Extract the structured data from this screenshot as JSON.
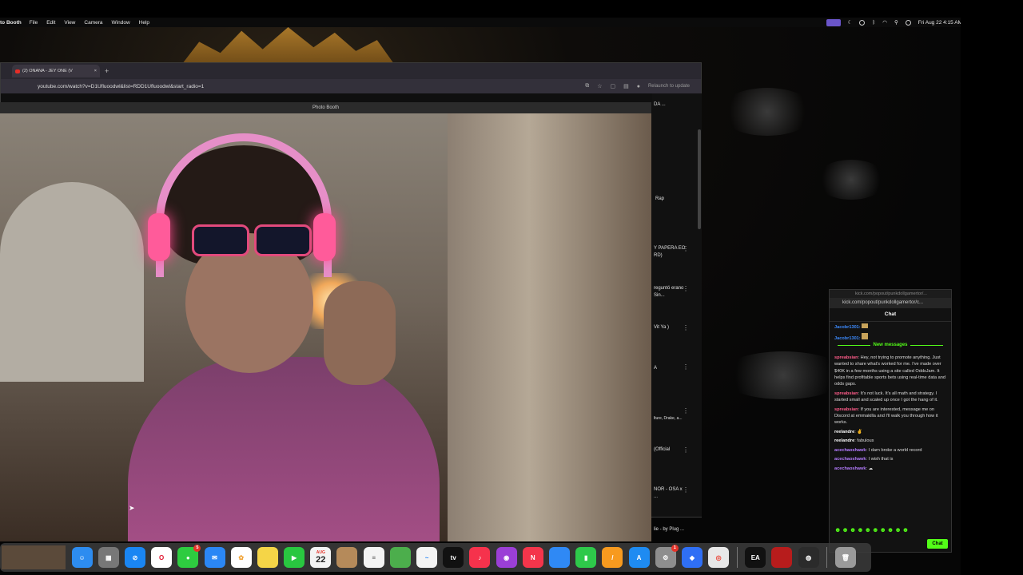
{
  "menubar": {
    "app_name": "to Booth",
    "items": [
      "File",
      "Edit",
      "View",
      "Camera",
      "Window",
      "Help"
    ],
    "datetime": "Fri Aug 22  4:15 AM"
  },
  "chrome": {
    "tab_title": "(2) ONANA - JEY ONE (V",
    "new_tab_glyph": "+",
    "url": "youtube.com/watch?v=D1Ufluoodwl&list=RDD1Ufluoodwl&start_radio=1",
    "relaunch": "Relaunch to update"
  },
  "photobooth": {
    "title": "Photo Booth"
  },
  "youtube_sidebar": {
    "items": [
      {
        "text": "DA ..."
      },
      {
        "text": "Rap"
      },
      {
        "text": "Y PAPERA EO RD)"
      },
      {
        "text": "reguntó erano Sin..."
      },
      {
        "text": "Vit Ya )"
      },
      {
        "text": "A"
      },
      {
        "text": "lture, Drake, a..."
      },
      {
        "text": "(Official"
      },
      {
        "text": "NOR - OSA x ..."
      },
      {
        "text": "lie - by Plug ..."
      }
    ]
  },
  "kick": {
    "window_title": "kick.com/popout/punkdollgamertor/...",
    "url": "kick.com/popout/punkdollgamertor/c...",
    "header": "Chat",
    "new_messages_label": "New messages",
    "top_users": [
      "Jacobr1301:",
      "Jacobr1301:"
    ],
    "messages": [
      {
        "user": "spreabsian",
        "color": "#ff5c8a",
        "text": "Hey, not trying to promote anything. Just wanted to share what's worked for me. I've made over $40K in a few months using a site called OddsJam. It helps find profitable sports bets using real-time data and odds gaps."
      },
      {
        "user": "spreabsian",
        "color": "#ff5c8a",
        "text": "It's not luck. It's all math and strategy. I started small and scaled up once I got the hang of it."
      },
      {
        "user": "spreabsian",
        "color": "#ff5c8a",
        "text": "If you are interested, message me on Discord at emmakilla and I'll walk you through how it works."
      },
      {
        "user": "reelandre",
        "color": "#ffffff",
        "text": ""
      },
      {
        "user": "reelandre",
        "color": "#ffffff",
        "text": "fabulous"
      },
      {
        "user": "acechaoshawk",
        "color": "#b47cff",
        "text": "I darn broke a world record"
      },
      {
        "user": "acechaoshawk",
        "color": "#b47cff",
        "text": "I wish that is"
      },
      {
        "user": "acechaoshawk",
        "color": "#b47cff",
        "text": ""
      }
    ],
    "chat_button": "Chat"
  },
  "dock": {
    "calendar_month": "AUG",
    "calendar_day": "22",
    "messages_badge": "5",
    "settings_badge": "1",
    "icons": [
      {
        "name": "finder-icon",
        "color": "#2d8cf0",
        "glyph": ""
      },
      {
        "name": "launchpad-icon",
        "color": "#888",
        "glyph": "▦"
      },
      {
        "name": "safari-icon",
        "color": "#1a86f3",
        "glyph": "⊘"
      },
      {
        "name": "opera-icon",
        "color": "#e0142e",
        "glyph": "O"
      },
      {
        "name": "messages-icon",
        "color": "#2ecc40",
        "glyph": "●"
      },
      {
        "name": "mail-icon",
        "color": "#2b87f5",
        "glyph": "✉"
      },
      {
        "name": "photos-icon",
        "color": "#f0a030",
        "glyph": "✿"
      },
      {
        "name": "notes-icon",
        "color": "#f5d547",
        "glyph": ""
      },
      {
        "name": "facetime-icon",
        "color": "#29c740",
        "glyph": "▶"
      },
      {
        "name": "calendar-icon",
        "color": "#f4f4f4",
        "glyph": ""
      },
      {
        "name": "contacts-icon",
        "color": "#b58a5a",
        "glyph": ""
      },
      {
        "name": "reminders-icon",
        "color": "#f4f4f4",
        "glyph": "≡"
      },
      {
        "name": "maps-icon",
        "color": "#4cae4c",
        "glyph": ""
      },
      {
        "name": "freeform-icon",
        "color": "#f4f4f4",
        "glyph": "~"
      },
      {
        "name": "apple-tv-icon",
        "color": "#111",
        "glyph": "tv"
      },
      {
        "name": "music-icon",
        "color": "#f6324c",
        "glyph": "♪"
      },
      {
        "name": "podcasts-icon",
        "color": "#9b3fd6",
        "glyph": ""
      },
      {
        "name": "news-icon",
        "color": "#f4354b",
        "glyph": "N"
      },
      {
        "name": "keynote-icon",
        "color": "#2f89f5",
        "glyph": ""
      },
      {
        "name": "numbers-icon",
        "color": "#2ec94a",
        "glyph": "▮"
      },
      {
        "name": "pages-icon",
        "color": "#f79a1f",
        "glyph": "/"
      },
      {
        "name": "app-store-icon",
        "color": "#1e8bf2",
        "glyph": "A"
      },
      {
        "name": "system-settings-icon",
        "color": "#8e8e8e",
        "glyph": "⚙"
      },
      {
        "name": "roblox-icon",
        "color": "#2f6ff5",
        "glyph": "◆"
      },
      {
        "name": "chrome-icon",
        "color": "#e8e8e8",
        "glyph": ""
      },
      {
        "name": "ea-icon",
        "color": "#111",
        "glyph": "EA"
      },
      {
        "name": "game-icon",
        "color": "#b71c1c",
        "glyph": ""
      },
      {
        "name": "obs-icon",
        "color": "#2b2b2b",
        "glyph": ""
      },
      {
        "name": "trash-icon",
        "color": "#9a9a9a",
        "glyph": ""
      }
    ]
  }
}
